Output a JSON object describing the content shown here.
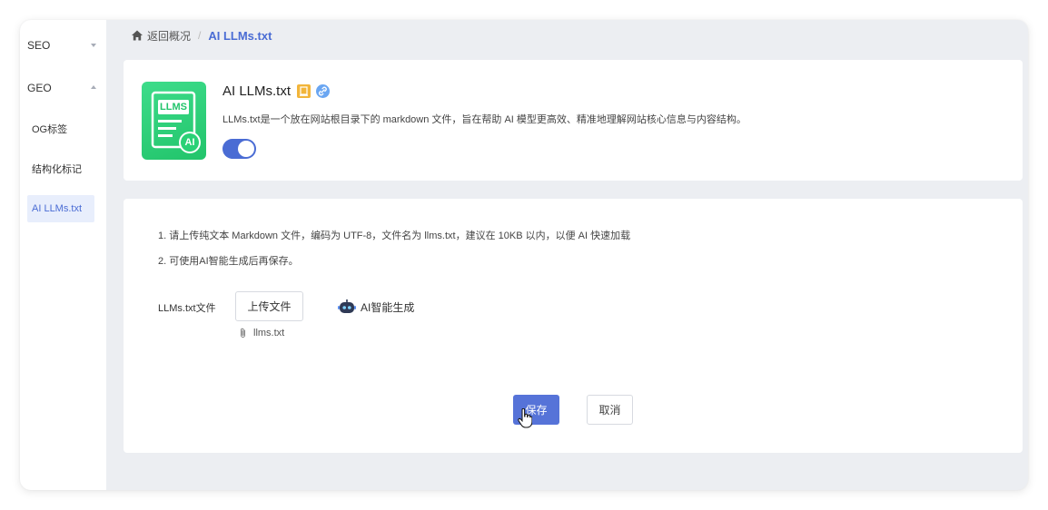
{
  "sidebar": {
    "groups": [
      {
        "label": "SEO",
        "expanded": false
      },
      {
        "label": "GEO",
        "expanded": true
      }
    ],
    "items": [
      {
        "label": "OG标签"
      },
      {
        "label": "结构化标记"
      },
      {
        "label": "AI LLMs.txt",
        "active": true
      }
    ]
  },
  "breadcrumb": {
    "icon": "home-icon",
    "back_label": "返回概况",
    "separator": "/",
    "current": "AI LLMs.txt"
  },
  "header_card": {
    "logo_text": "LLMS",
    "logo_badge": "AI",
    "title": "AI LLMs.txt",
    "title_icons": [
      "document-badge-icon",
      "link-badge-icon"
    ],
    "description": "LLMs.txt是一个放在网站根目录下的 markdown 文件，旨在帮助 AI 模型更高效、精准地理解网站核心信息与内容结构。",
    "enabled": true
  },
  "main_card": {
    "notes": [
      "1. 请上传纯文本 Markdown 文件，编码为 UTF-8，文件名为 llms.txt，建议在 10KB 以内，以便 AI 快速加载",
      "2. 可使用AI智能生成后再保存。"
    ],
    "field_label": "LLMs.txt文件",
    "upload_label": "上传文件",
    "ai_generate_label": "AI智能生成",
    "uploaded_file": "llms.txt"
  },
  "actions": {
    "save_label": "保存",
    "cancel_label": "取消"
  },
  "colors": {
    "accent": "#4a6cd4",
    "logo_green": "#2ad176",
    "background": "#eceef2"
  }
}
